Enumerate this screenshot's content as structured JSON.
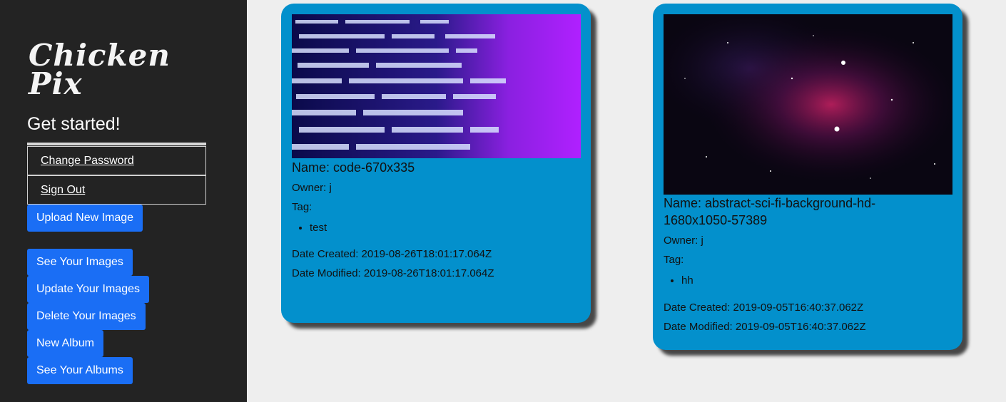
{
  "app": {
    "brand": "Chicken Pix",
    "brand_line1": "Chicken",
    "brand_line2": "Pix",
    "subtitle": "Get started!"
  },
  "sidebar": {
    "change_password": "Change Password",
    "sign_out": "Sign Out",
    "upload": "Upload New Image",
    "see_images": "See Your Images",
    "update_images": "Update Your Images",
    "delete_images": "Delete Your Images",
    "new_album": "New Album",
    "see_albums": "See Your Albums"
  },
  "images": [
    {
      "name": "Name: code-670x335",
      "owner": "Owner: j",
      "tag_label": "Tag:",
      "tags": [
        "test"
      ],
      "created": "Date Created: 2019-08-26T18:01:17.064Z",
      "modified": "Date Modified: 2019-08-26T18:01:17.064Z"
    },
    {
      "name": "Name: abstract-sci-fi-background-hd-1680x1050-57389",
      "owner": "Owner: j",
      "tag_label": "Tag:",
      "tags": [
        "hh"
      ],
      "created": "Date Created: 2019-09-05T16:40:37.062Z",
      "modified": "Date Modified: 2019-09-05T16:40:37.062Z"
    }
  ],
  "colors": {
    "sidebar_bg": "#232323",
    "button_blue": "#1a6ef5",
    "card_blue": "#0390cc",
    "page_bg": "#eeeeee"
  }
}
